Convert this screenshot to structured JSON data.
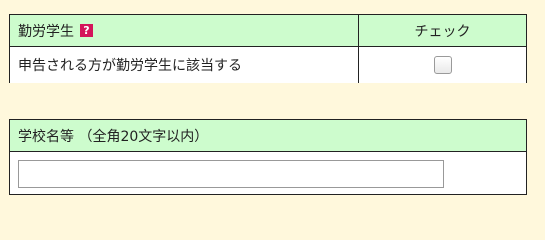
{
  "student_section": {
    "header_label": "勤労学生",
    "help_icon": "question-mark-icon",
    "check_header": "チェック",
    "row_label": "申告される方が勤労学生に該当する",
    "checked": false
  },
  "school_section": {
    "header_label": "学校名等 （全角20文字以内）",
    "input_value": ""
  },
  "colors": {
    "page_background": "#fff8dc",
    "header_background": "#cdfccd",
    "help_icon_background": "#d4145a"
  }
}
